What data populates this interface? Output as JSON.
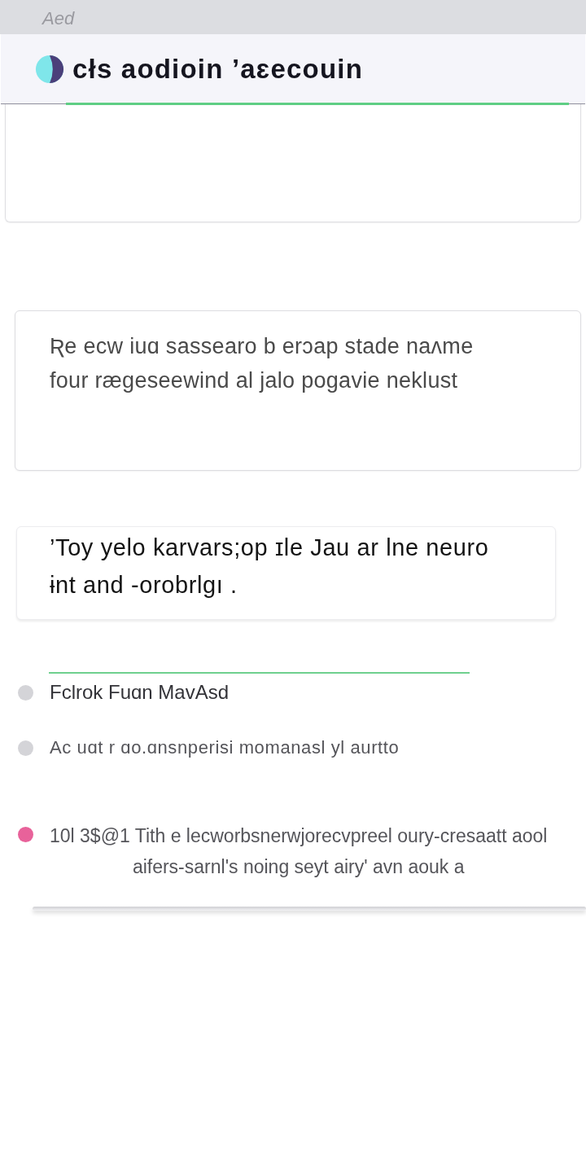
{
  "top_bar": {
    "title": "Aed"
  },
  "panel": {
    "title": "cłs aodioin ’aɛecouin"
  },
  "cards": [
    {
      "kind": "plain",
      "lines": [
        "Ʀe ecw iuɑ sassearo b erɔap stade naʌme",
        "four rægeseewind al jalo pogavie neklust"
      ]
    },
    {
      "kind": "emphasis",
      "lines": [
        "’Toy yelo karvars;op ɪle Jau ar lne neuro",
        "ɨnt and ‑orobrlgı ."
      ]
    }
  ],
  "list": {
    "items": [
      {
        "kind": "heading",
        "color": "#d4d4d8",
        "lines": [
          "Fclrok Fuɑn MavAsd"
        ]
      },
      {
        "kind": "plain",
        "color": "#d4d4d8",
        "lines": [
          "Ac uɑt r ɑo.ɑnsnperisi momanasl yl aurtto"
        ]
      },
      {
        "kind": "paragraph",
        "color": "#e8629a",
        "lines": [
          "10l 3$@1 Tith e lecworbsnerwjorecvpreel oury-cresaatt aool",
          "aifers-sarnl's noing seyt airy' avn aouk a"
        ]
      }
    ]
  }
}
